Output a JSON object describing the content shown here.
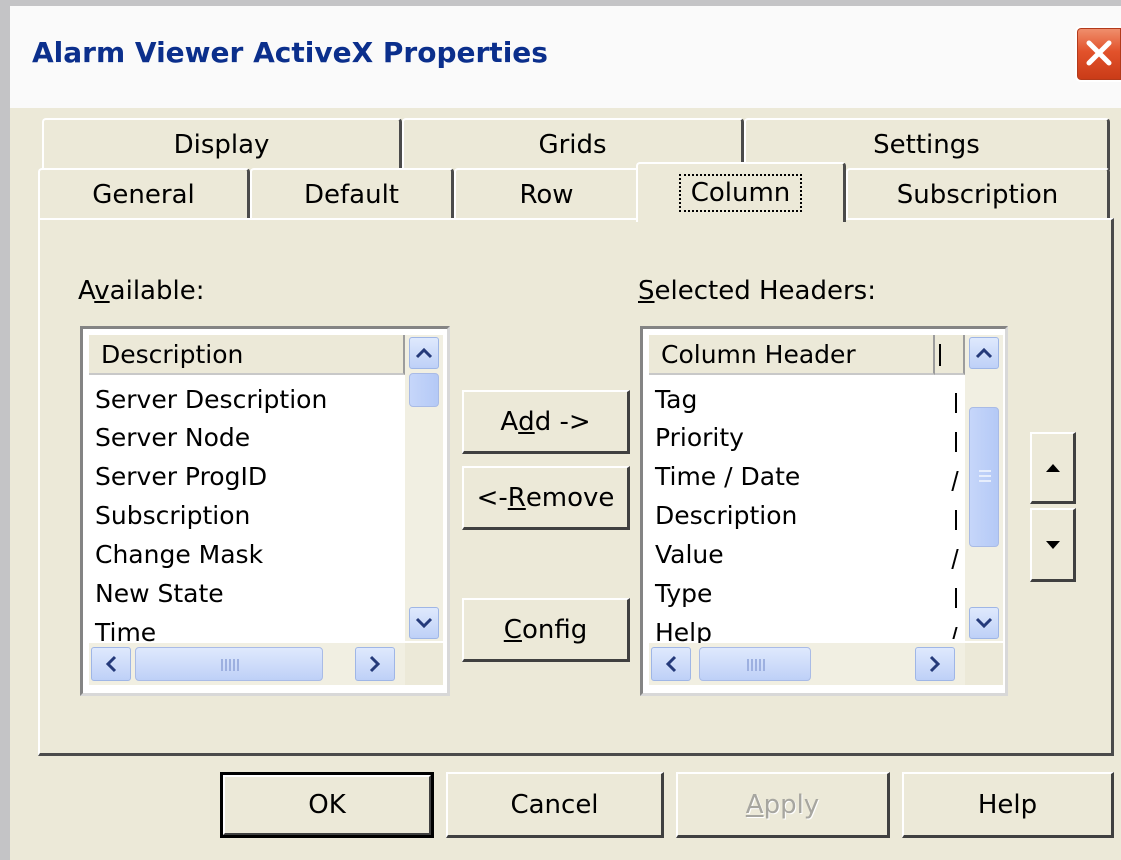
{
  "window": {
    "title": "Alarm Viewer  ActiveX Properties"
  },
  "tabs": {
    "row_back": [
      {
        "label": "Display"
      },
      {
        "label": "Grids"
      },
      {
        "label": "Settings"
      }
    ],
    "row_front": [
      {
        "label": "General"
      },
      {
        "label": "Default"
      },
      {
        "label": "Row"
      },
      {
        "label": "Column",
        "active": true
      },
      {
        "label": "Subscription"
      }
    ]
  },
  "available": {
    "label_pre": "A",
    "label_mnemonic": "v",
    "label_post": "ailable:",
    "header": "Description",
    "items": [
      "Server Description",
      "Server Node",
      "Server ProgID",
      "Subscription",
      "Change Mask",
      "New State",
      "Time"
    ]
  },
  "selected": {
    "label_mnemonic": "S",
    "label_post": "elected Headers:",
    "header": "Column Header",
    "items": [
      "Tag",
      "Priority",
      "Time / Date",
      "Description",
      "Value",
      "Type",
      "Help"
    ]
  },
  "buttons": {
    "add_pre": "A",
    "add_mnemonic": "d",
    "add_post": "d ->",
    "remove_pre": "<- ",
    "remove_mnemonic": "R",
    "remove_post": "emove",
    "config_mnemonic": "C",
    "config_post": "onfig",
    "ok": "OK",
    "cancel": "Cancel",
    "apply_mnemonic": "A",
    "apply_post": "pply",
    "help": "Help"
  },
  "icons": {
    "close": "close-x-icon",
    "move_up": "triangle-up-icon",
    "move_down": "triangle-down-icon"
  },
  "colors": {
    "title_text": "#0b2f8c",
    "close_button": "#e2522b",
    "dialog_face": "#ece9d8",
    "scroll_accent": "#bed0f7"
  }
}
